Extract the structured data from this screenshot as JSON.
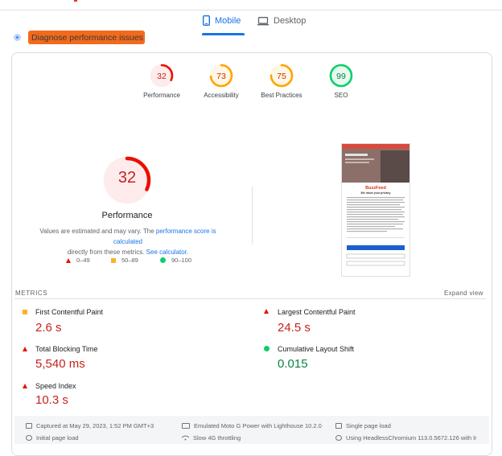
{
  "tabs": [
    {
      "label": "Mobile",
      "active": true
    },
    {
      "label": "Desktop",
      "active": false
    }
  ],
  "diagnose": {
    "label": "Diagnose performance issues",
    "highlight_color": "#f26a1c"
  },
  "gauges": [
    {
      "label": "Performance",
      "score": 32,
      "color": "#eb0f00",
      "bg": "#fdeceb"
    },
    {
      "label": "Accessibility",
      "score": 73,
      "color": "#ffa400",
      "bg": "#fff6e5"
    },
    {
      "label": "Best Practices",
      "score": 75,
      "color": "#ffa400",
      "bg": "#fff6e5"
    },
    {
      "label": "SEO",
      "score": 99,
      "color": "#0cce6b",
      "bg": "#e6fbef"
    }
  ],
  "performance": {
    "score": 32,
    "title": "Performance",
    "desc_1": "Values are estimated and may vary. The ",
    "desc_link_1": "performance score is calculated",
    "desc_2": "directly from these metrics. ",
    "desc_link_2": "See calculator."
  },
  "legend": [
    {
      "shape": "triangle",
      "range": "0–49"
    },
    {
      "shape": "square",
      "range": "50–89"
    },
    {
      "shape": "circle",
      "range": "90–100"
    }
  ],
  "screenshot": {
    "brand": "BuzzFeed",
    "heading": "We value your privacy"
  },
  "metrics": {
    "label": "METRICS",
    "expand": "Expand view",
    "items": [
      {
        "name": "First Contentful Paint",
        "value": "2.6 s",
        "status": "average"
      },
      {
        "name": "Largest Contentful Paint",
        "value": "24.5 s",
        "status": "fail"
      },
      {
        "name": "Total Blocking Time",
        "value": "5,540 ms",
        "status": "fail"
      },
      {
        "name": "Cumulative Layout Shift",
        "value": "0.015",
        "status": "pass"
      },
      {
        "name": "Speed Index",
        "value": "10.3 s",
        "status": "fail"
      }
    ]
  },
  "footer": {
    "captured": "Captured at May 29, 2023, 1:52 PM GMT+3",
    "initial": "Initial page load",
    "emulated": "Emulated Moto G Power with Lighthouse 10.2.0",
    "throttling": "Slow 4G throttling",
    "single": "Single page load",
    "using": "Using HeadlessChromium 113.0.5672.126 with lr"
  }
}
